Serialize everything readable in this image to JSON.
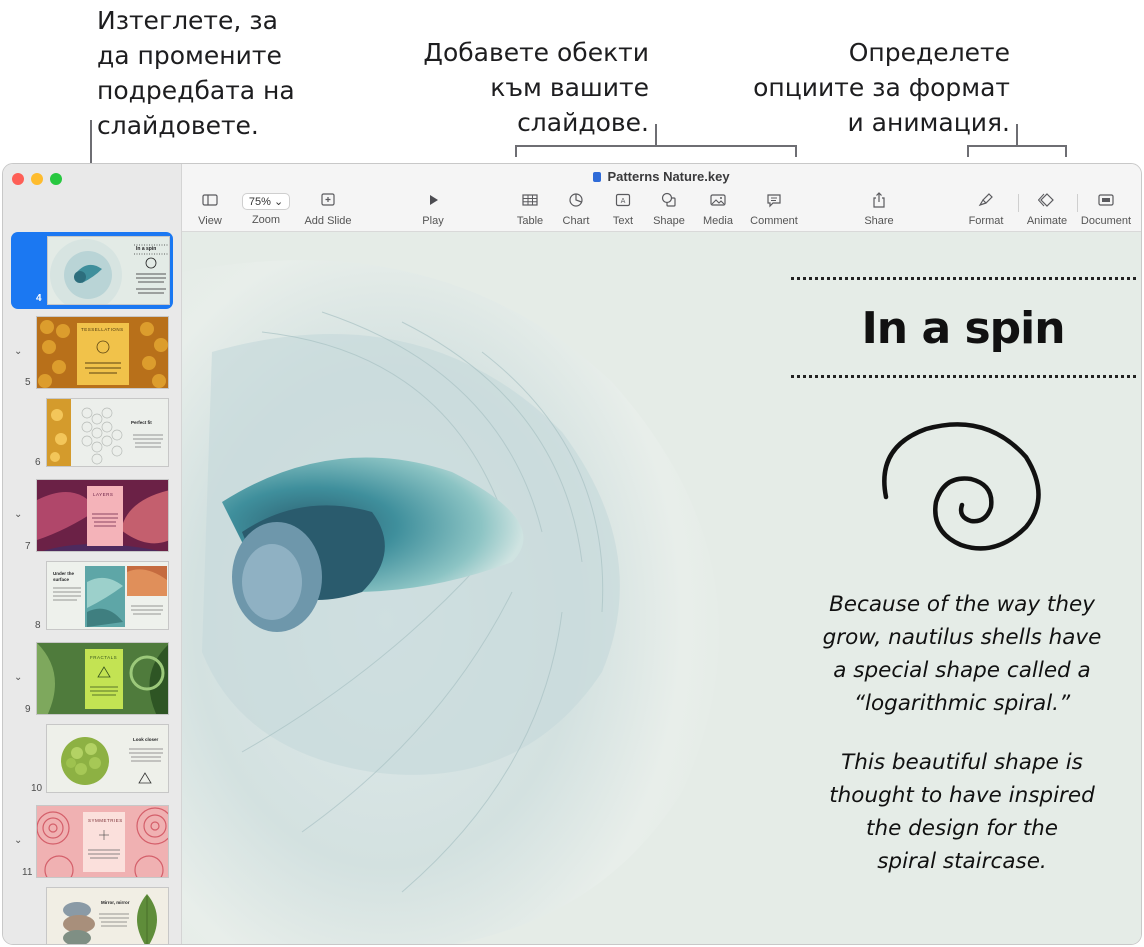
{
  "callouts": {
    "left": "Изтеглете, за\nда промените\nподредбата на\nслайдовете.",
    "middle": "Добавете обекти\nкъм вашите\nслайдове.",
    "right": "Определете\nопциите за формат\nи анимация."
  },
  "window": {
    "title": "Patterns Nature.key",
    "traffic_colors": [
      "#fe5f57",
      "#febc2e",
      "#28c840"
    ]
  },
  "toolbar": {
    "view": "View",
    "zoom_value": "75%",
    "zoom": "Zoom",
    "add_slide": "Add Slide",
    "play": "Play",
    "table": "Table",
    "chart": "Chart",
    "text": "Text",
    "shape": "Shape",
    "media": "Media",
    "comment": "Comment",
    "share": "Share",
    "format": "Format",
    "animate": "Animate",
    "document": "Document"
  },
  "slides": [
    {
      "number": "4",
      "title": "In a spin",
      "selected": true,
      "collapsible": false
    },
    {
      "number": "5",
      "title": "TESSELLATIONS",
      "selected": false,
      "collapsible": true
    },
    {
      "number": "6",
      "title": "Perfect fit",
      "selected": false,
      "collapsible": false
    },
    {
      "number": "7",
      "title": "LAYERS",
      "selected": false,
      "collapsible": true
    },
    {
      "number": "8",
      "title": "Under the surface",
      "selected": false,
      "collapsible": false
    },
    {
      "number": "9",
      "title": "FRACTALS",
      "selected": false,
      "collapsible": true
    },
    {
      "number": "10",
      "title": "Look closer",
      "selected": false,
      "collapsible": false
    },
    {
      "number": "11",
      "title": "SYMMETRIES",
      "selected": false,
      "collapsible": true
    },
    {
      "number": "",
      "title": "Mirror, mirror",
      "selected": false,
      "collapsible": false
    }
  ],
  "slide": {
    "title": "In a spin",
    "paragraph1": "Because of the way they\ngrow, nautilus shells have\na special shape called a\n“logarithmic spiral.”",
    "paragraph2": "This beautiful shape is\nthought to have inspired\nthe design for the\nspiral staircase."
  },
  "colors": {
    "selection": "#1b78f2",
    "canvas_bg": "#e5ece7",
    "shell_teal": "#3f8f9c"
  }
}
